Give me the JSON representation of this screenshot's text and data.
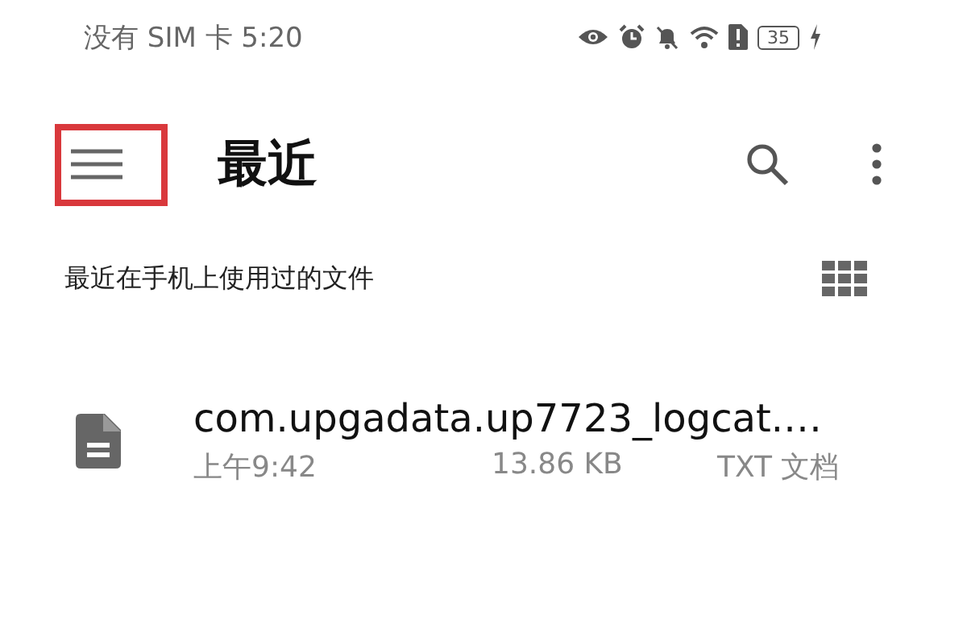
{
  "status_bar": {
    "carrier_time": "没有 SIM 卡 5:20",
    "battery": "35"
  },
  "toolbar": {
    "menu_highlighted": true,
    "title": "最近"
  },
  "section": {
    "heading": "最近在手机上使用过的文件"
  },
  "files": [
    {
      "name": "com.upgadata.up7723_logcat.…",
      "time": "上午9:42",
      "size": "13.86 KB",
      "type": "TXT 文档"
    }
  ]
}
